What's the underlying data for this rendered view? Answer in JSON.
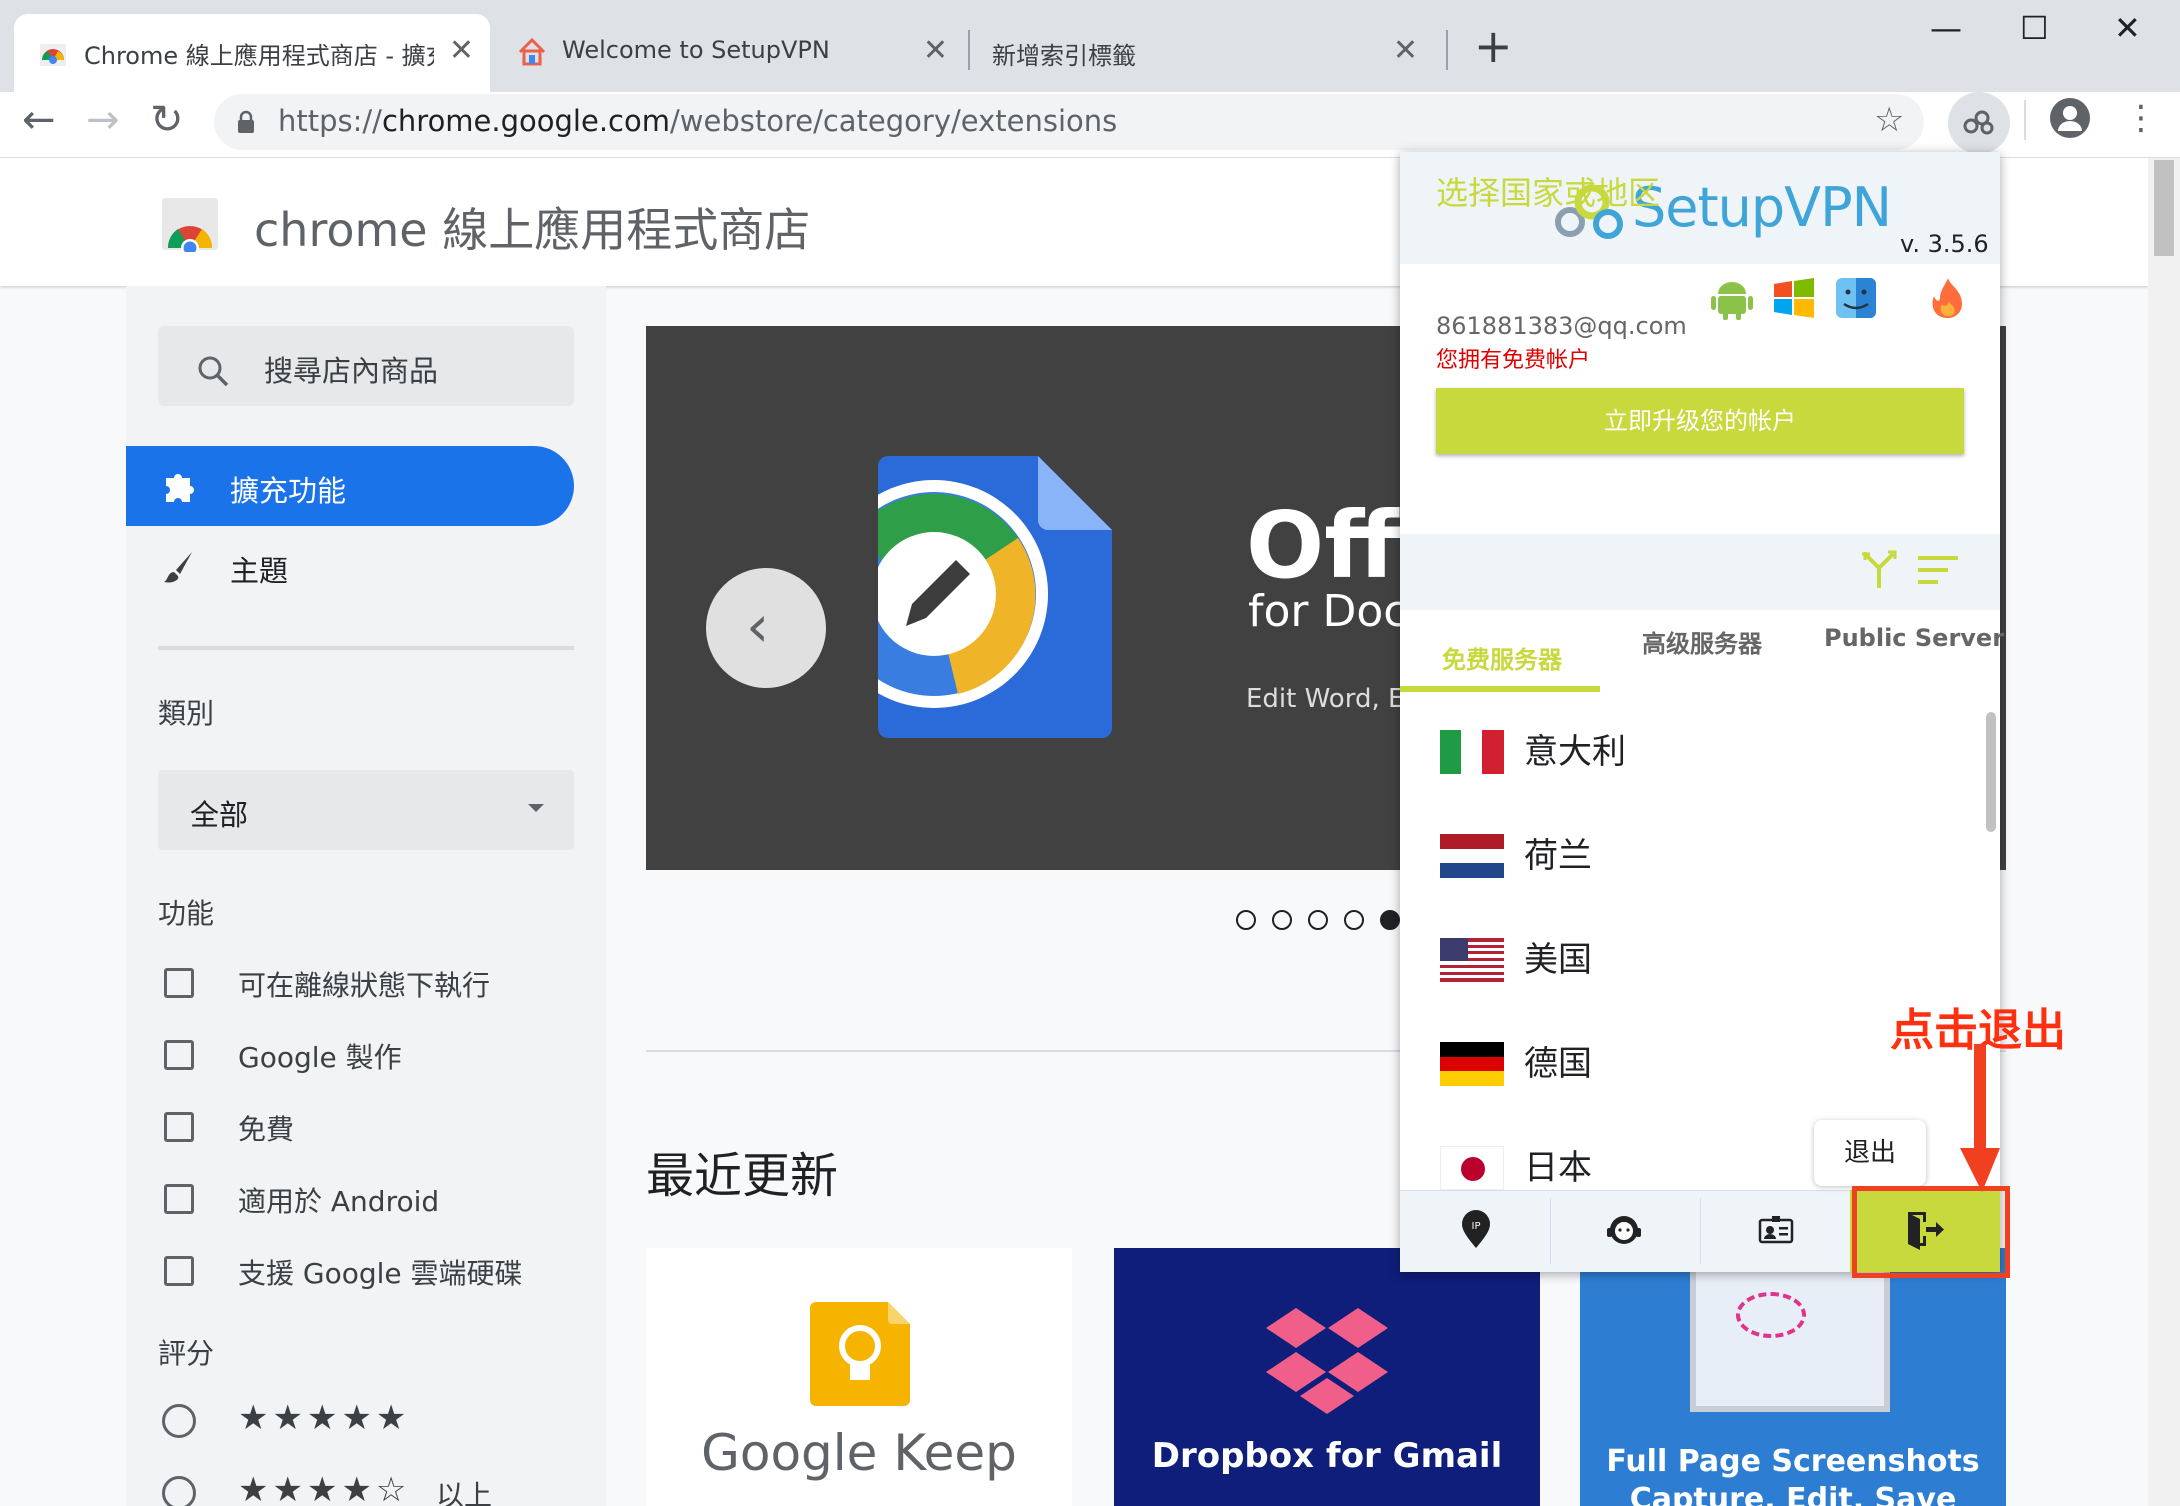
{
  "browser": {
    "tabs": [
      {
        "title": "Chrome 線上應用程式商店 - 擴充功能",
        "active": true
      },
      {
        "title": "Welcome to SetupVPN",
        "active": false
      },
      {
        "title": "新增索引標籤",
        "active": false
      }
    ],
    "new_tab_label": "+",
    "window_controls": {
      "minimize": "—",
      "maximize": "☐",
      "close": "✕"
    },
    "url_prefix": "https://",
    "url_domain": "chrome.google.com",
    "url_path": "/webstore/category/extensions"
  },
  "store": {
    "title": "chrome 線上應用程式商店",
    "search_placeholder": "搜尋店內商品",
    "nav": {
      "extensions": "擴充功能",
      "themes": "主題"
    },
    "category_heading": "類別",
    "category_value": "全部",
    "features_heading": "功能",
    "features": [
      "可在離線狀態下執行",
      "Google 製作",
      "免費",
      "適用於 Android",
      "支援 Google 雲端硬碟"
    ],
    "rating_heading": "評分",
    "ratings": [
      {
        "stars": 5,
        "label": "★★★★★",
        "suffix": ""
      },
      {
        "stars": 4,
        "label": "★★★★☆",
        "suffix": "以上"
      }
    ],
    "hero": {
      "title": "Offic",
      "subtitle": "for Docs",
      "desc": "Edit Word, Ex"
    },
    "carousel": {
      "count": 5,
      "active_index": 4
    },
    "recent_heading": "最近更新",
    "cards": [
      {
        "name": "Google Keep",
        "bg": "#ffffff"
      },
      {
        "name": "Dropbox for Gmail",
        "bg": "#0e1e7a"
      },
      {
        "name": "Full Page Screenshots",
        "line2": "Capture, Edit, Save",
        "bg": "#2d7dd2"
      }
    ]
  },
  "vpn": {
    "brand": "SetupVPN",
    "version": "v. 3.5.6",
    "email": "861881383@qq.com",
    "account_status": "您拥有免费帐户",
    "upgrade_button": "立即升级您的帐户",
    "country_title": "选择国家或地区",
    "tabs": [
      "免费服务器",
      "高级服务器",
      "Public Server"
    ],
    "countries": [
      "意大利",
      "荷兰",
      "美国",
      "德国",
      "日本"
    ],
    "tooltip": "退出",
    "bottom_icons": [
      "ip-icon",
      "support-icon",
      "account-icon",
      "logout-icon"
    ],
    "accent_color": "#c7d93d"
  },
  "annotation": {
    "text": "点击退出",
    "color": "#ff3010"
  }
}
